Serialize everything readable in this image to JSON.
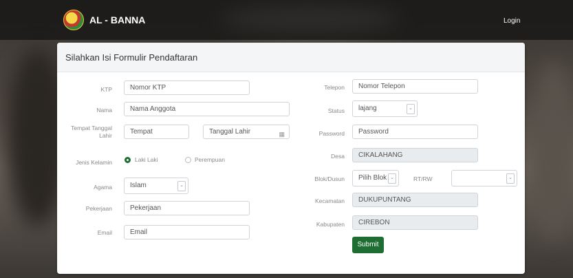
{
  "navbar": {
    "brand": "AL - BANNA",
    "login": "Login"
  },
  "form": {
    "title": "Silahkan Isi Formulir Pendaftaran",
    "left": {
      "ktp": {
        "label": "KTP",
        "placeholder": "Nomor KTP"
      },
      "nama": {
        "label": "Nama",
        "placeholder": "Nama Anggota"
      },
      "ttl": {
        "label_line1": "Tempat Tanggal",
        "label_line2": "Lahir",
        "tempat_placeholder": "Tempat",
        "tanggal_placeholder": "Tanggal Lahir"
      },
      "gender": {
        "label": "Jenis Kelamin",
        "option_male": "Laki Laki",
        "option_female": "Perempuan",
        "selected": "Laki Laki"
      },
      "agama": {
        "label": "Agama",
        "value": "Islam"
      },
      "pekerjaan": {
        "label": "Pekerjaan",
        "placeholder": "Pekerjaan"
      },
      "email": {
        "label": "Email",
        "placeholder": "Email"
      }
    },
    "right": {
      "telepon": {
        "label": "Telepon",
        "placeholder": "Nomor Telepon"
      },
      "status": {
        "label": "Status",
        "value": "lajang"
      },
      "password": {
        "label": "Password",
        "placeholder": "Password"
      },
      "desa": {
        "label": "Desa",
        "value": "CIKALAHANG"
      },
      "blok": {
        "label": "Blok/Dusun",
        "value": "Pilih Blok"
      },
      "rtrw": {
        "label": "RT/RW",
        "value": ""
      },
      "kecamatan": {
        "label": "Kecamatan",
        "value": "DUKUPUNTANG"
      },
      "kabupaten": {
        "label": "Kabupaten",
        "value": "CIREBON"
      },
      "submit": "Submit"
    }
  },
  "colors": {
    "accent": "#1e6e34",
    "navbar": "#141414"
  },
  "icons": {
    "calendar": "calendar-icon",
    "select": "chevron-down-icon"
  }
}
